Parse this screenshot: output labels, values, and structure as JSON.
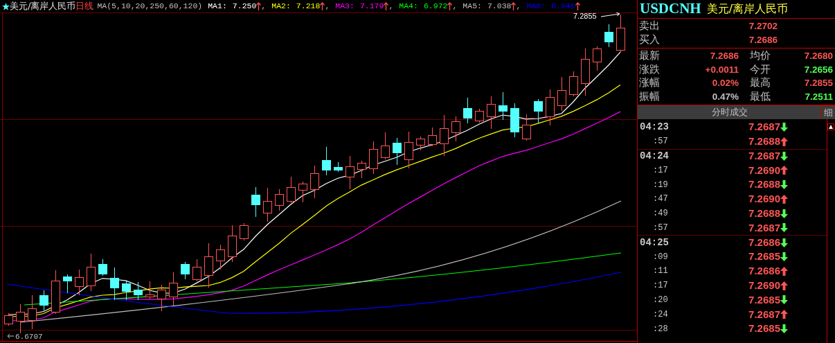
{
  "chart": {
    "title": "美元/离岸人民币",
    "period": "日线",
    "ma_label": "MA(5,10,20,250,60,120)",
    "indicators": [
      {
        "name": "MA1:",
        "value": "7.250",
        "rising": true,
        "color": "#ffffff",
        "separator": ","
      },
      {
        "name": "MA2:",
        "value": "7.218",
        "rising": true,
        "color": "#ffff00",
        "separator": ","
      },
      {
        "name": "MA3:",
        "value": "7.179",
        "rising": true,
        "color": "#ff00ff",
        "separator": ","
      },
      {
        "name": "MA4:",
        "value": "6.972",
        "rising": true,
        "color": "#00ff00",
        "separator": ","
      },
      {
        "name": "MA5:",
        "value": "7.038",
        "rising": true,
        "color": "#c0c0c0",
        "separator": ","
      },
      {
        "name": "MA6:",
        "value": "6.946",
        "rising": true,
        "color": "#0000ff"
      }
    ],
    "high_label": "7.2855",
    "low_label": "6.6707"
  },
  "quote": {
    "code": "USDCNH",
    "name": "美元/离岸人民币",
    "book": [
      {
        "label": "卖出",
        "value": "7.2702",
        "color": "#ff5555"
      },
      {
        "label": "买入",
        "value": "7.2686",
        "color": "#ff5555"
      }
    ],
    "stats": [
      {
        "left": {
          "label": "最新",
          "value": "7.2686",
          "color": "#ff5555"
        },
        "right": {
          "label": "均价",
          "value": "7.2680",
          "color": "#ff5555"
        }
      },
      {
        "left": {
          "label": "涨跌",
          "value": "+0.0011",
          "color": "#ff5555"
        },
        "right": {
          "label": "今开",
          "value": "7.2656",
          "color": "#55ff55"
        }
      },
      {
        "left": {
          "label": "涨幅",
          "value": "0.02%",
          "color": "#ff5555"
        },
        "right": {
          "label": "最高",
          "value": "7.2855",
          "color": "#ff5555"
        }
      },
      {
        "left": {
          "label": "振幅",
          "value": "0.47%",
          "color": "#c0c0c0"
        },
        "right": {
          "label": "最低",
          "value": "7.2511",
          "color": "#55ff55"
        }
      }
    ]
  },
  "ticks_header": {
    "title": "分时成交",
    "tab": "细"
  },
  "ticks": [
    {
      "time": "04:23",
      "kind": "minute",
      "price": "7.2687",
      "rising": false
    },
    {
      "time": ":57",
      "kind": "second",
      "price": "7.2688",
      "rising": true
    },
    {
      "time": "04:24",
      "kind": "minute",
      "price": "7.2687",
      "rising": false
    },
    {
      "time": ":17",
      "kind": "second",
      "price": "7.2690",
      "rising": true
    },
    {
      "time": ":19",
      "kind": "second",
      "price": "7.2688",
      "rising": false
    },
    {
      "time": ":47",
      "kind": "second",
      "price": "7.2690",
      "rising": true
    },
    {
      "time": ":49",
      "kind": "second",
      "price": "7.2688",
      "rising": false
    },
    {
      "time": ":57",
      "kind": "second",
      "price": "7.2687",
      "rising": false
    },
    {
      "time": "04:25",
      "kind": "minute",
      "price": "7.2686",
      "rising": false
    },
    {
      "time": ":09",
      "kind": "second",
      "price": "7.2685",
      "rising": false
    },
    {
      "time": ":11",
      "kind": "second",
      "price": "7.2686",
      "rising": true
    },
    {
      "time": ":17",
      "kind": "second",
      "price": "7.2690",
      "rising": true
    },
    {
      "time": ":20",
      "kind": "second",
      "price": "7.2685",
      "rising": false
    },
    {
      "time": ":24",
      "kind": "second",
      "price": "7.2687",
      "rising": true
    },
    {
      "time": ":28",
      "kind": "second",
      "price": "7.2685",
      "rising": false
    }
  ]
}
